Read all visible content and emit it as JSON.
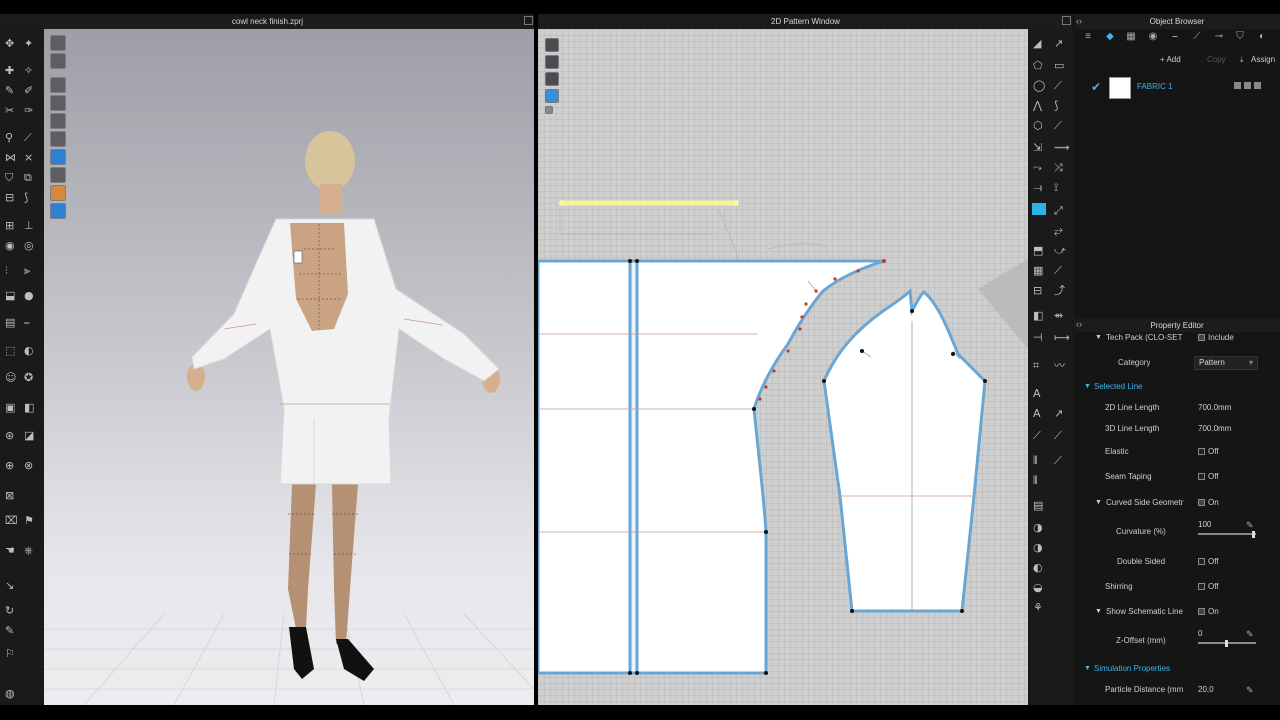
{
  "windows": {
    "view3d_title": "cowl neck finish.zprj",
    "pattern_title": "2D Pattern Window",
    "object_browser_title": "Object Browser",
    "property_editor_title": "Property Editor"
  },
  "object_browser": {
    "tabs": [
      "list-icon",
      "fabric-icon",
      "grid-icon",
      "button-icon",
      "line-icon",
      "stitch-icon",
      "measure-icon",
      "shirt-icon",
      "sphere-icon"
    ],
    "actions": {
      "add": "+ Add",
      "copy": "Copy",
      "assign": "Assign"
    },
    "fabric_item": {
      "name": "FABRIC 1",
      "checked": true,
      "color": "#ffffff"
    }
  },
  "property_editor": {
    "tech_pack": {
      "label": "Tech Pack (CLO-SET",
      "value": "Include"
    },
    "category": {
      "label": "Category",
      "value": "Pattern"
    },
    "selected_line": {
      "label": "Selected Line"
    },
    "line_2d_length": {
      "label": "2D Line Length",
      "value": "700.0mm"
    },
    "line_3d_length": {
      "label": "3D Line Length",
      "value": "700.0mm"
    },
    "elastic": {
      "label": "Elastic",
      "value": "Off"
    },
    "seam_taping": {
      "label": "Seam Taping",
      "value": "Off"
    },
    "curved_side": {
      "label": "Curved Side Geometr",
      "value": "On"
    },
    "curvature": {
      "label": "Curvature (%)",
      "value": "100",
      "level": 1.0
    },
    "double_sided": {
      "label": "Double Sided",
      "value": "Off"
    },
    "shirring": {
      "label": "Shirring",
      "value": "Off"
    },
    "show_schematic": {
      "label": "Show Schematic Line",
      "value": "On"
    },
    "z_offset": {
      "label": "Z-Offset (mm)",
      "value": "0",
      "level": 0.5
    },
    "simulation": {
      "label": "Simulation Properties"
    },
    "particle_distance": {
      "label": "Particle Distance (mm",
      "value": "20,0"
    }
  },
  "colors": {
    "accent": "#3fb3ea",
    "pattern_outline": "#6aa6d4",
    "selected_line": "#f2f59a",
    "panel_bg": "#151515"
  }
}
